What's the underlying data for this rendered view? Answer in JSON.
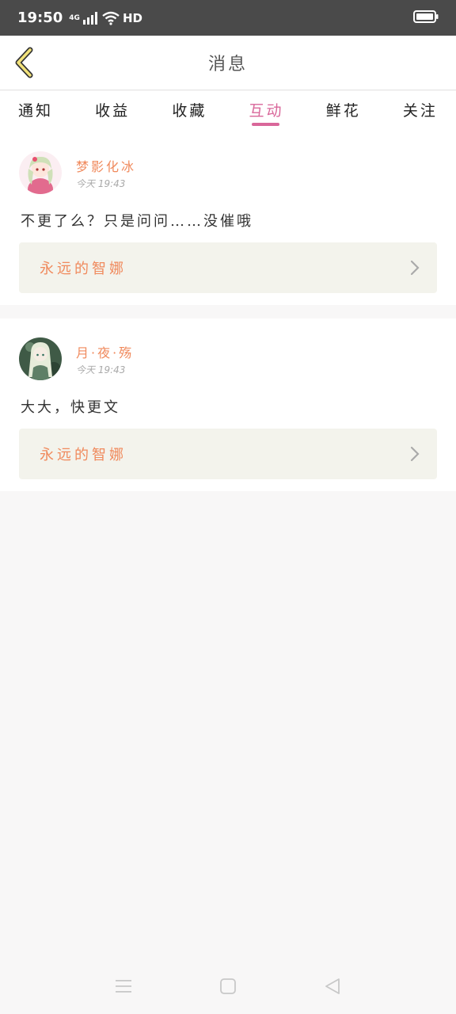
{
  "status_bar": {
    "time": "19:50",
    "network": "4G",
    "hd": "HD"
  },
  "header": {
    "title": "消息"
  },
  "tabs": [
    {
      "label": "通知"
    },
    {
      "label": "收益"
    },
    {
      "label": "收藏"
    },
    {
      "label": "互动",
      "active": true
    },
    {
      "label": "鲜花"
    },
    {
      "label": "关注"
    }
  ],
  "messages": [
    {
      "user": "梦影化冰",
      "time": "今天 19:43",
      "text": "不更了么？只是问问……没催哦",
      "book": "永远的智娜"
    },
    {
      "user": "月·夜·殇",
      "time": "今天 19:43",
      "text": "大大，快更文",
      "book": "永远的智娜"
    }
  ],
  "colors": {
    "accent": "#d9679a",
    "username": "#f08a5d",
    "link_bg": "#f3f3ec"
  }
}
